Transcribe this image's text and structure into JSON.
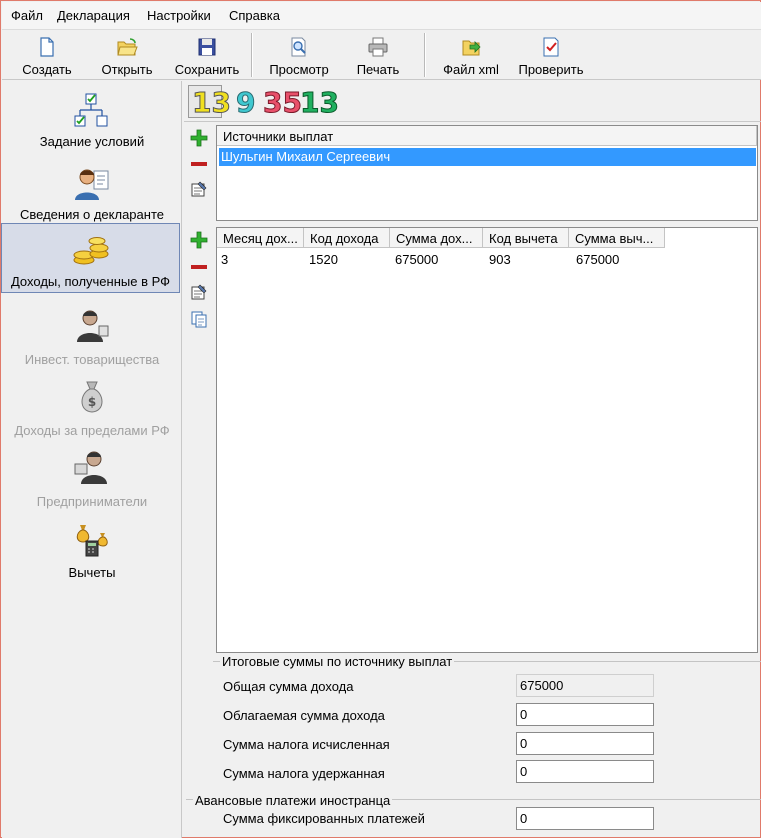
{
  "menu": [
    "Файл",
    "Декларация",
    "Настройки",
    "Справка"
  ],
  "toolbar": {
    "create": "Создать",
    "open": "Открыть",
    "save": "Сохранить",
    "preview": "Просмотр",
    "print": "Печать",
    "xml": "Файл xml",
    "check": "Проверить"
  },
  "nav": {
    "conditions": "Задание условий",
    "declarant": "Сведения о декларанте",
    "income_rf": "Доходы, полученные в РФ",
    "invest": "Инвест. товарищества",
    "income_abroad": "Доходы за пределами РФ",
    "entrepreneurs": "Предприниматели",
    "deductions": "Вычеты"
  },
  "years": [
    "13",
    "9",
    "35",
    "13"
  ],
  "colors": {
    "accent": "#3399ff",
    "year1": "#f0e020",
    "year2": "#40c8d0",
    "year3": "#e8506a",
    "year4": "#20b060"
  },
  "sources": {
    "header": "Источники выплат",
    "rows": [
      "Шульгин Михаил Сергеевич"
    ]
  },
  "income_table": {
    "headers": [
      "Месяц дох...",
      "Код дохода",
      "Сумма дох...",
      "Код вычета",
      "Сумма выч..."
    ],
    "rows": [
      [
        "3",
        "1520",
        "675000",
        "903",
        "675000"
      ]
    ]
  },
  "totals": {
    "title": "Итоговые суммы по источнику выплат",
    "total_income_label": "Общая сумма дохода",
    "total_income_value": "675000",
    "taxable_label": "Облагаемая сумма дохода",
    "taxable_value": "0",
    "tax_calc_label": "Сумма налога исчисленная",
    "tax_calc_value": "0",
    "tax_withheld_label": "Сумма налога удержанная",
    "tax_withheld_value": "0"
  },
  "advance": {
    "title": "Авансовые платежи иностранца",
    "fixed_label": "Сумма фиксированных платежей",
    "fixed_value": "0"
  }
}
